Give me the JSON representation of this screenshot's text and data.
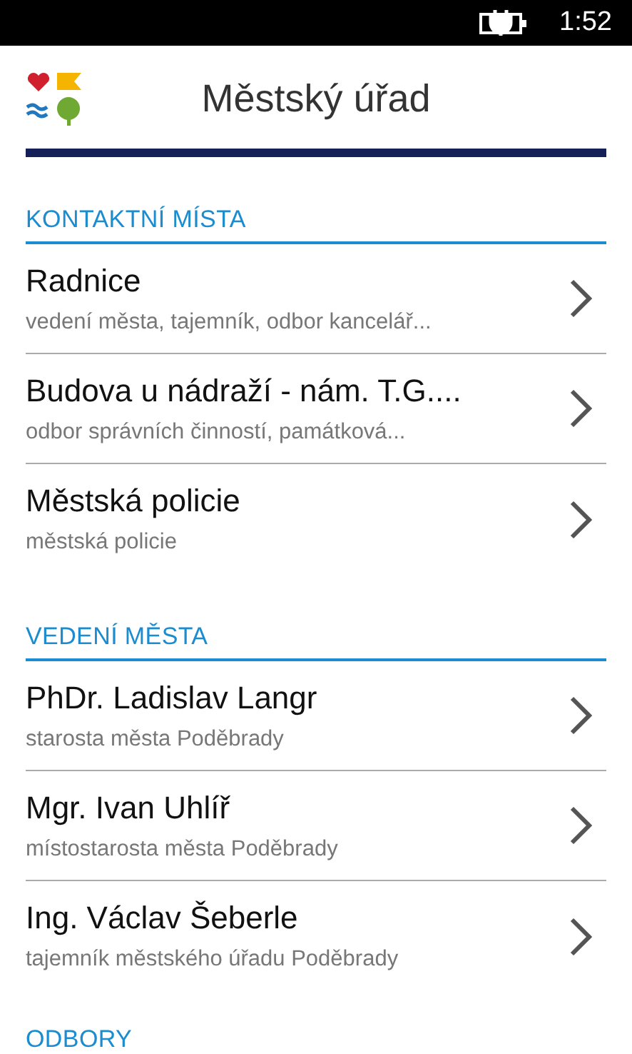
{
  "status_bar": {
    "time": "1:52"
  },
  "header": {
    "title": "Městský úřad"
  },
  "sections": [
    {
      "heading": "KONTAKTNÍ MÍSTA",
      "items": [
        {
          "title": "Radnice",
          "subtitle": "vedení města, tajemník, odbor kancelář..."
        },
        {
          "title": "Budova u nádraží - nám. T.G....",
          "subtitle": "odbor správních činností, památková..."
        },
        {
          "title": "Městská policie",
          "subtitle": "městská policie"
        }
      ]
    },
    {
      "heading": "VEDENÍ MĚSTA",
      "items": [
        {
          "title": "PhDr. Ladislav Langr",
          "subtitle": "starosta města Poděbrady"
        },
        {
          "title": "Mgr. Ivan Uhlíř",
          "subtitle": "místostarosta města Poděbrady"
        },
        {
          "title": "Ing. Václav Šeberle",
          "subtitle": "tajemník městského úřadu Poděbrady"
        }
      ]
    },
    {
      "heading": "ODBORY"
    }
  ]
}
